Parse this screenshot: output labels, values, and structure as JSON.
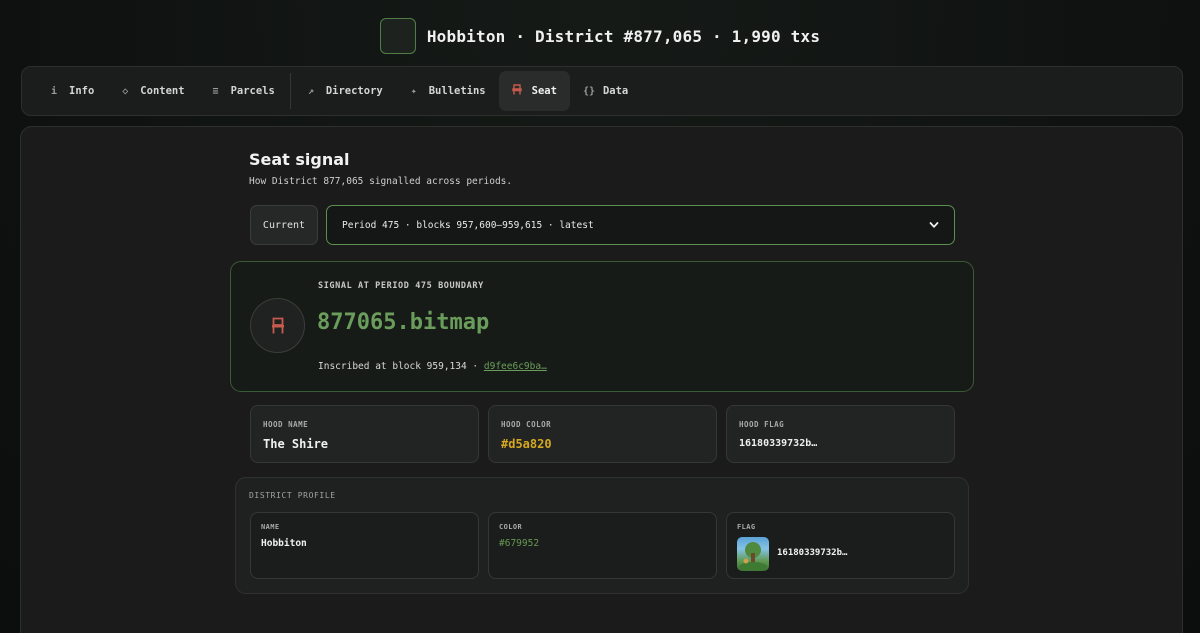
{
  "header": {
    "title": "Hobbiton · District #877,065 · 1,990 txs"
  },
  "tabs": [
    {
      "icon": "info-icon",
      "glyph": "i",
      "label": "Info"
    },
    {
      "icon": "diamond-icon",
      "glyph": "◇",
      "label": "Content"
    },
    {
      "icon": "list-icon",
      "glyph": "≡",
      "label": "Parcels"
    },
    {
      "icon": "arrow-up-right-icon",
      "glyph": "↗",
      "label": "Directory"
    },
    {
      "icon": "sparkle-icon",
      "glyph": "✦",
      "label": "Bulletins"
    },
    {
      "icon": "chair-icon",
      "glyph": "⑁",
      "label": "Seat",
      "active": true
    },
    {
      "icon": "braces-icon",
      "glyph": "{}",
      "label": "Data"
    }
  ],
  "seat": {
    "title": "Seat signal",
    "subtitle": "How District 877,065 signalled across periods.",
    "current_label": "Current",
    "period_value": "Period 475 · blocks 957,600–959,615 · latest"
  },
  "signal": {
    "label": "SIGNAL AT PERIOD 475 BOUNDARY",
    "value": "877065.bitmap",
    "inscribed_prefix": "Inscribed at block 959,134 · ",
    "tx_link": "d9fee6c9ba…"
  },
  "hood": {
    "name_label": "HOOD NAME",
    "name_value": "The Shire",
    "color_label": "HOOD COLOR",
    "color_value": "#d5a820",
    "flag_label": "HOOD FLAG",
    "flag_value": "16180339732b…"
  },
  "profile": {
    "label": "DISTRICT PROFILE",
    "name_label": "NAME",
    "name_value": "Hobbiton",
    "color_label": "COLOR",
    "color_value": "#679952",
    "flag_label": "FLAG",
    "flag_value": "16180339732b…"
  },
  "colors": {
    "accent_green": "#6a9d5c",
    "seat_icon": "#c75a4d",
    "hood_color": "#d5a820",
    "district_color": "#679952"
  }
}
